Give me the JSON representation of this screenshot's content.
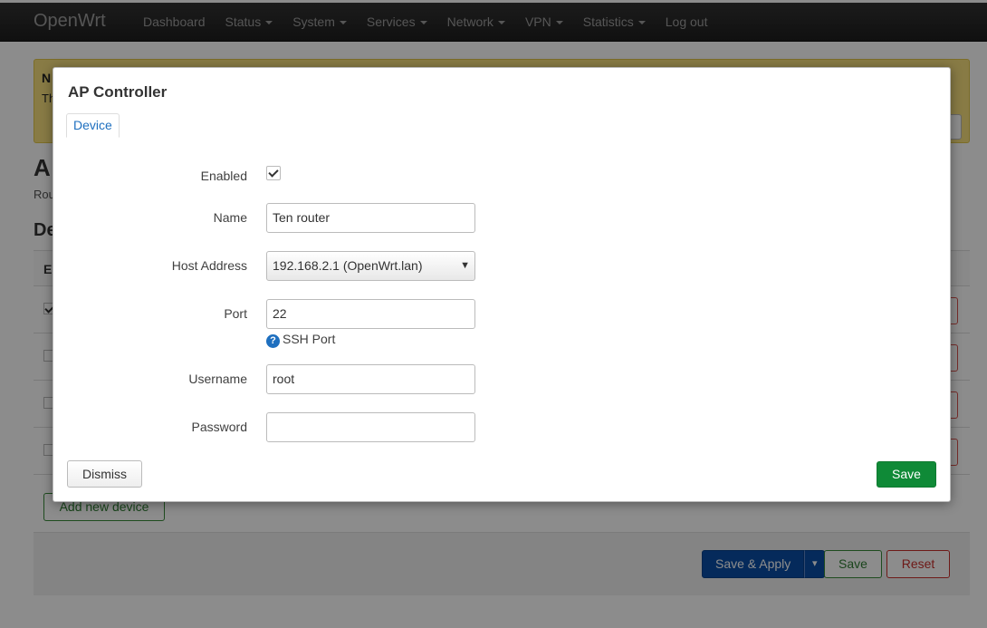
{
  "app": {
    "brand": "OpenWrt",
    "nav": [
      {
        "label": "Dashboard",
        "caret": false
      },
      {
        "label": "Status",
        "caret": true
      },
      {
        "label": "System",
        "caret": true
      },
      {
        "label": "Services",
        "caret": true
      },
      {
        "label": "Network",
        "caret": true
      },
      {
        "label": "VPN",
        "caret": true
      },
      {
        "label": "Statistics",
        "caret": true
      },
      {
        "label": "Log out",
        "caret": false
      }
    ]
  },
  "background": {
    "notice_title": "N",
    "notice_text": "Th",
    "page_title": "A",
    "page_desc": "Rou",
    "section_title": "De",
    "table_head": "E",
    "add_button": "Add new device",
    "save_apply": "Save & Apply",
    "save": "Save",
    "reset": "Reset"
  },
  "modal": {
    "title": "AP Controller",
    "tab": "Device",
    "fields": {
      "enabled_label": "Enabled",
      "enabled_checked": true,
      "name_label": "Name",
      "name_value": "Ten router",
      "host_label": "Host Address",
      "host_value": "192.168.2.1 (OpenWrt.lan)",
      "port_label": "Port",
      "port_value": "22",
      "port_help": "SSH Port",
      "username_label": "Username",
      "username_value": "root",
      "password_label": "Password",
      "password_value": ""
    },
    "dismiss": "Dismiss",
    "save": "Save"
  },
  "colors": {
    "accent": "#1e6fbf",
    "save_green": "#0f8a37",
    "notice_yellow": "#f7e17e"
  }
}
